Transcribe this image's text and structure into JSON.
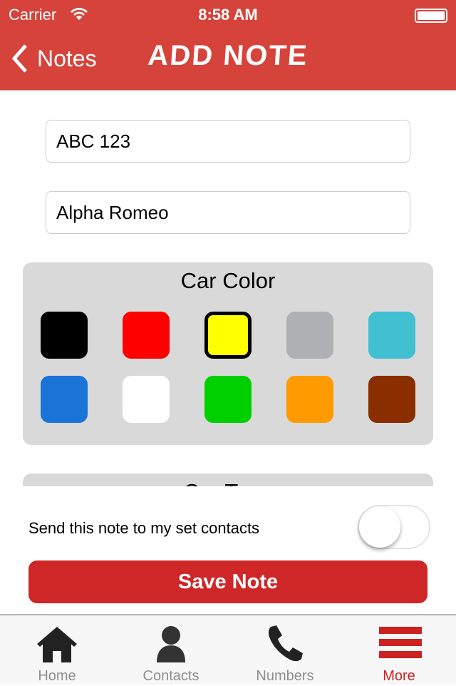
{
  "status_bar": {
    "carrier": "Carrier",
    "time": "8:58 AM"
  },
  "nav": {
    "back_label": "Notes",
    "title": "ADD NOTE"
  },
  "form": {
    "plate_value": "ABC 123",
    "model_value": "Alpha Romeo"
  },
  "car_color": {
    "title": "Car Color",
    "selected": "yellow",
    "swatches": [
      {
        "name": "black",
        "color": "#000000"
      },
      {
        "name": "red",
        "color": "#ff0000"
      },
      {
        "name": "yellow",
        "color": "#ffff00"
      },
      {
        "name": "gray",
        "color": "#aeb0b3"
      },
      {
        "name": "cyan",
        "color": "#40c0d0"
      },
      {
        "name": "blue",
        "color": "#1a74d8"
      },
      {
        "name": "white",
        "color": "#ffffff"
      },
      {
        "name": "green",
        "color": "#00d000"
      },
      {
        "name": "orange",
        "color": "#ff9a00"
      },
      {
        "name": "brown",
        "color": "#8a2e00"
      }
    ]
  },
  "car_type": {
    "title": "Car Type"
  },
  "send": {
    "label": "Send this note to my set contacts",
    "enabled": false
  },
  "save_label": "Save Note",
  "tabs": [
    {
      "label": "Home",
      "icon": "home-icon"
    },
    {
      "label": "Contacts",
      "icon": "person-icon"
    },
    {
      "label": "Numbers",
      "icon": "phone-icon"
    },
    {
      "label": "More",
      "icon": "menu-icon",
      "active": true
    }
  ],
  "colors": {
    "accent": "#d6433a",
    "button": "#cf2727",
    "active_tab": "#cc2222"
  }
}
